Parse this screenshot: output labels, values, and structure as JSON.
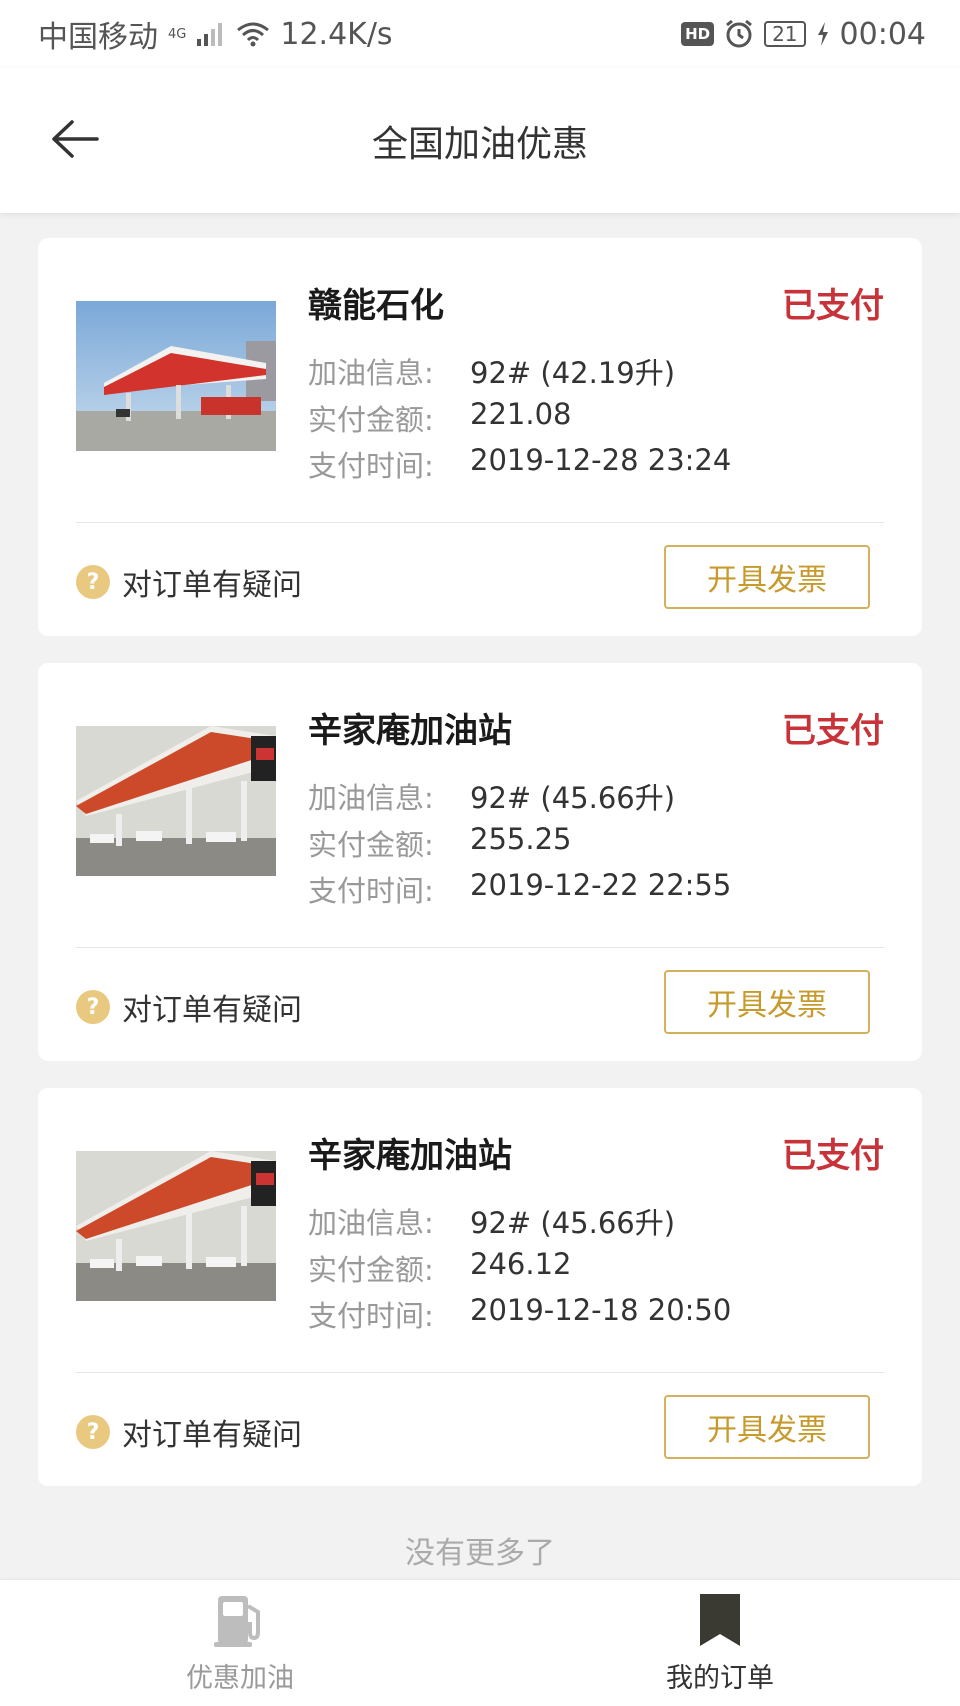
{
  "status_bar": {
    "carrier": "中国移动",
    "network": "4G",
    "speed": "12.4K/s",
    "hd": "HD",
    "battery": "21",
    "time": "00:04"
  },
  "header": {
    "title": "全国加油优惠"
  },
  "orders": [
    {
      "station": "赣能石化",
      "status": "已支付",
      "fuel_label": "加油信息:",
      "fuel_value": "92# (42.19升)",
      "paid_label": "实付金额:",
      "paid_value": "221.08",
      "time_label": "支付时间:",
      "time_value": "2019-12-28 23:24",
      "question": "对订单有疑问",
      "invoice_button": "开具发票"
    },
    {
      "station": "辛家庵加油站",
      "status": "已支付",
      "fuel_label": "加油信息:",
      "fuel_value": "92# (45.66升)",
      "paid_label": "实付金额:",
      "paid_value": "255.25",
      "time_label": "支付时间:",
      "time_value": "2019-12-22 22:55",
      "question": "对订单有疑问",
      "invoice_button": "开具发票"
    },
    {
      "station": "辛家庵加油站",
      "status": "已支付",
      "fuel_label": "加油信息:",
      "fuel_value": "92# (45.66升)",
      "paid_label": "实付金额:",
      "paid_value": "246.12",
      "time_label": "支付时间:",
      "time_value": "2019-12-18 20:50",
      "question": "对订单有疑问",
      "invoice_button": "开具发票"
    }
  ],
  "footer_text": "没有更多了",
  "bottom_nav": {
    "items": [
      {
        "label": "优惠加油",
        "icon": "fuel-pump-icon",
        "active": false
      },
      {
        "label": "我的订单",
        "icon": "bookmark-icon",
        "active": true
      }
    ]
  },
  "colors": {
    "status_paid": "#c8333a",
    "accent_gold": "#d4b15e",
    "question_icon": "#e9c97f",
    "background": "#f2f2f2"
  }
}
